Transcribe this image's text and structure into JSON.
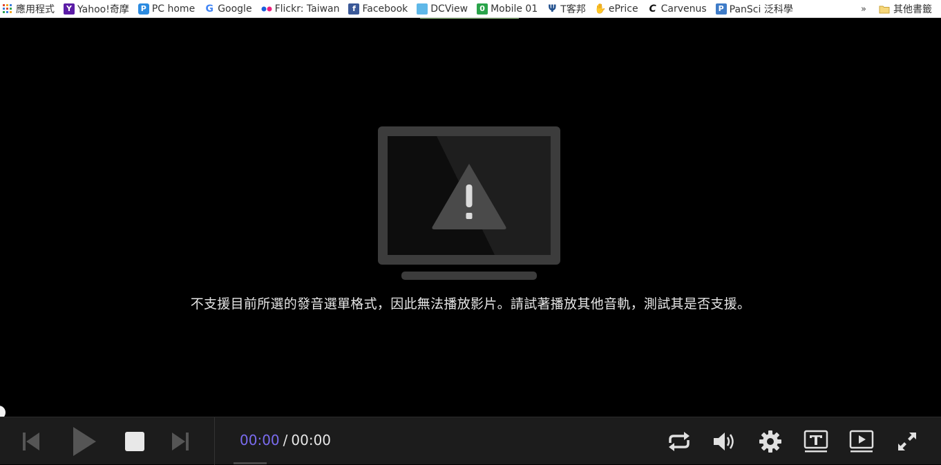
{
  "bookmarks": {
    "items": [
      {
        "label": "應用程式",
        "icon": "apps-grid-icon"
      },
      {
        "label": "Yahoo!奇摩",
        "icon": "yahoo-icon"
      },
      {
        "label": "PC home",
        "icon": "pchome-icon"
      },
      {
        "label": "Google",
        "icon": "google-icon"
      },
      {
        "label": "Flickr: Taiwan",
        "icon": "flickr-icon"
      },
      {
        "label": "Facebook",
        "icon": "facebook-icon"
      },
      {
        "label": "DCView",
        "icon": "dcview-icon"
      },
      {
        "label": "Mobile 01",
        "icon": "mobile01-icon"
      },
      {
        "label": "T客邦",
        "icon": "tkebang-icon"
      },
      {
        "label": "ePrice",
        "icon": "eprice-icon"
      },
      {
        "label": "Carvenus",
        "icon": "carvenus-icon"
      },
      {
        "label": "PanSci 泛科學",
        "icon": "pansci-icon"
      }
    ],
    "more": "»",
    "other": "其他書籤"
  },
  "player": {
    "error_message": "不支援目前所選的發音選單格式，因此無法播放影片。請試著播放其他音軌，測試其是否支援。",
    "time_current": "00:00",
    "time_separator": "/",
    "time_total": "00:00"
  },
  "colors": {
    "time_current": "#7b6cf0",
    "loading_bar": "#8fc17d",
    "control_bar": "#1c1c1c"
  }
}
